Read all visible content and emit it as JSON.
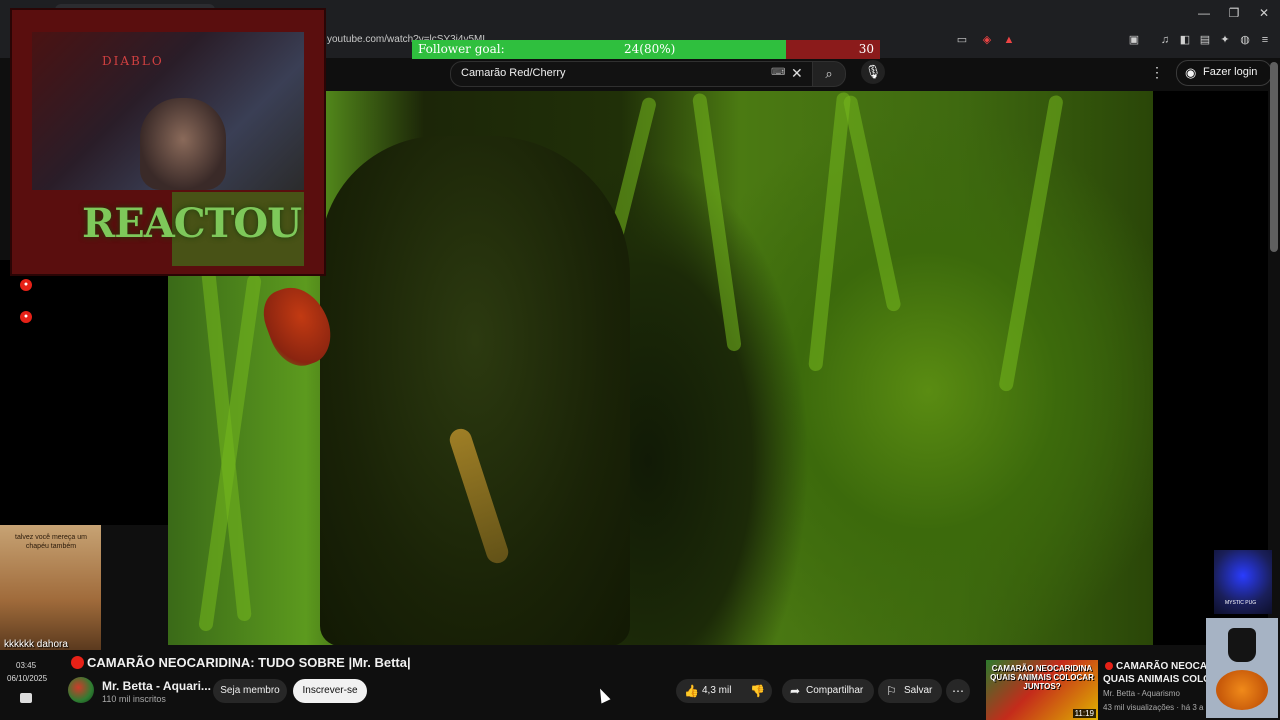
{
  "browser": {
    "url": "youtube.com/watch?v=lcSY3i4v5ML",
    "window_controls": [
      "—",
      "❐",
      "✕"
    ]
  },
  "follower_goal": {
    "label": "Follower goal:",
    "current": "24(80%)",
    "target": "30",
    "progress": 0.8
  },
  "youtube_header": {
    "search_value": "Camarão Red/Cherry",
    "login_label": "Fazer login"
  },
  "webcam_overlay": {
    "logo_text": "DIABLO",
    "react_text": "REACTOU"
  },
  "meme_overlay": {
    "top_text": "talvez você mereça um chapéu também",
    "bottom_text": "kkkkkk dahora"
  },
  "side_clock": {
    "time": "03:45",
    "date": "06/10/2025"
  },
  "video": {
    "title": "CAMARÃO NEOCARIDINA: TUDO SOBRE |Mr. Betta|",
    "channel_name": "Mr. Betta - Aquari...",
    "subscribers": "110 mil inscritos",
    "member_label": "Seja membro",
    "subscribe_label": "Inscrever-se",
    "likes": "4,3 mil",
    "share_label": "Compartilhar",
    "save_label": "Salvar"
  },
  "recommended": {
    "thumb_title": "CAMARÃO NEOCARIDINA QUAIS ANIMAIS COLOCAR JUNTOS?",
    "duration": "11:19",
    "title_line1": "CAMARÃO NEOCARID",
    "title_line2": "QUAIS ANIMAIS COLOCA",
    "channel": "Mr. Betta - Aquarismo",
    "meta": "43 mil visualizações · há 3 a"
  },
  "wizard_overlay_label": "MYSTIC PUG",
  "colors": {
    "youtube_red": "#e62117",
    "goal_fill": "#2fbf3e",
    "goal_remaining": "#8b1b1b",
    "background": "#0f0f0f"
  }
}
